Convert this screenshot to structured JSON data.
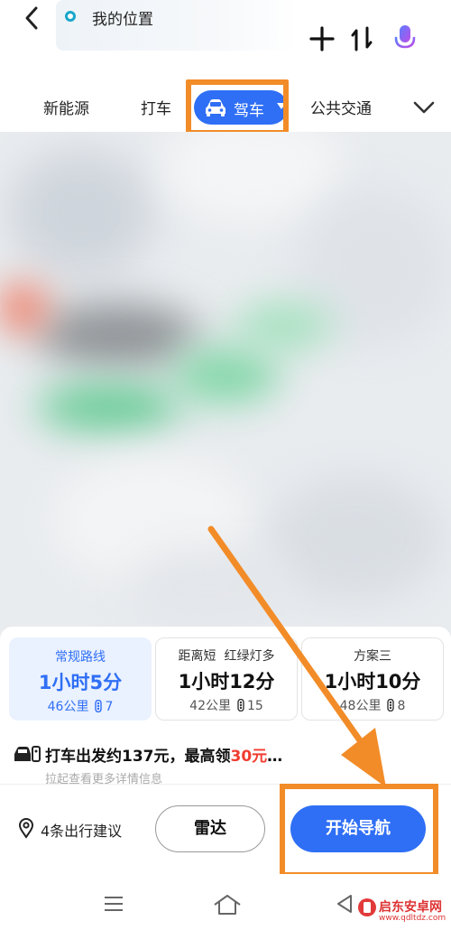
{
  "search": {
    "current_location": "我的位置"
  },
  "tabs": [
    {
      "label": "新能源"
    },
    {
      "label": "打车"
    },
    {
      "label": "驾车",
      "selected": true
    },
    {
      "label": "公共交通"
    }
  ],
  "routes": [
    {
      "name": "常规路线",
      "duration": "1小时5分",
      "distance": "46公里",
      "lights": "7",
      "selected": true
    },
    {
      "name": "距离短  红绿灯多",
      "duration": "1小时12分",
      "distance": "42公里",
      "lights": "15"
    },
    {
      "name": "方案三",
      "duration": "1小时10分",
      "distance": "48公里",
      "lights": "8"
    }
  ],
  "taxi": {
    "text_before": "打车出发约137元，最高领",
    "highlight": "30元",
    "text_after": "…"
  },
  "hint": "拉起查看更多详情信息",
  "actions": {
    "suggestions": "4条出行建议",
    "radar": "雷达",
    "start_nav": "开始导航"
  },
  "watermark": {
    "name": "启东安卓网",
    "url": "www.qdltdz.com"
  },
  "colors": {
    "primary": "#2f6ff5",
    "highlight_box": "#f28c28",
    "price_red": "#f03c2f"
  },
  "icons": [
    "back-icon",
    "location-dot-icon",
    "plus-icon",
    "swap-icon",
    "mic-icon",
    "car-icon",
    "chevron-down-icon",
    "traffic-light-icon",
    "taxi-icon",
    "pin-icon",
    "menu-icon",
    "home-icon",
    "back-triangle-icon"
  ]
}
